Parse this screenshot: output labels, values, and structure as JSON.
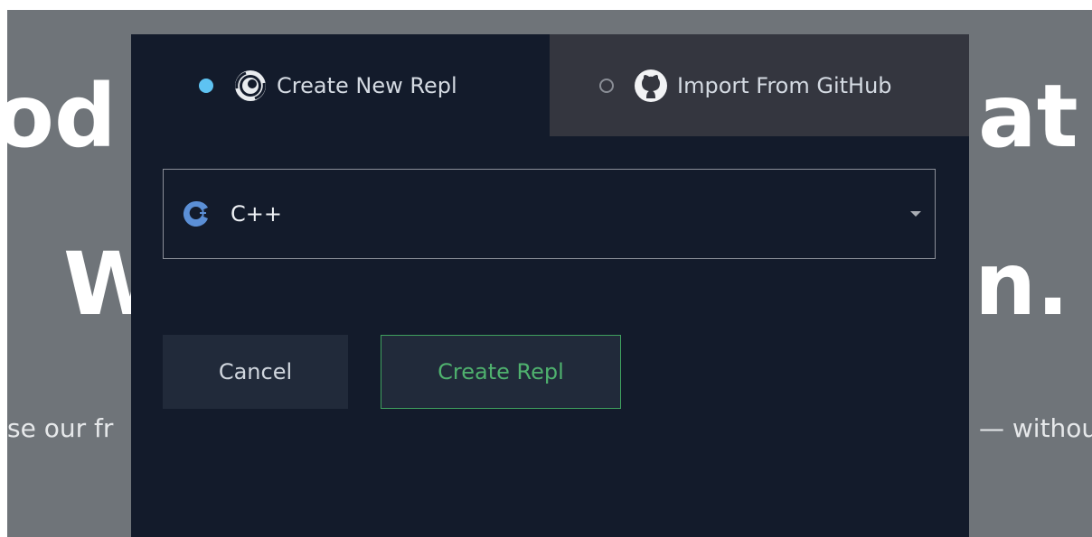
{
  "background": {
    "headline_line1_left": "od",
    "headline_line1_right": "at",
    "headline_line2_left": "W",
    "headline_line2_right": "n.",
    "subtext_left": "se our fr",
    "subtext_right": "— withou"
  },
  "modal": {
    "tabs": [
      {
        "label": "Create New Repl",
        "selected": true,
        "icon": "repl-spiral-icon"
      },
      {
        "label": "Import From GitHub",
        "selected": false,
        "icon": "github-icon"
      }
    ],
    "language_select": {
      "value": "C++",
      "icon": "cpp-icon"
    },
    "buttons": {
      "cancel_label": "Cancel",
      "create_label": "Create Repl"
    }
  },
  "colors": {
    "modal_bg": "#131b2b",
    "inactive_tab_bg": "#34363f",
    "accent_blue": "#5ec3f2",
    "accent_green": "#4fb16e"
  }
}
